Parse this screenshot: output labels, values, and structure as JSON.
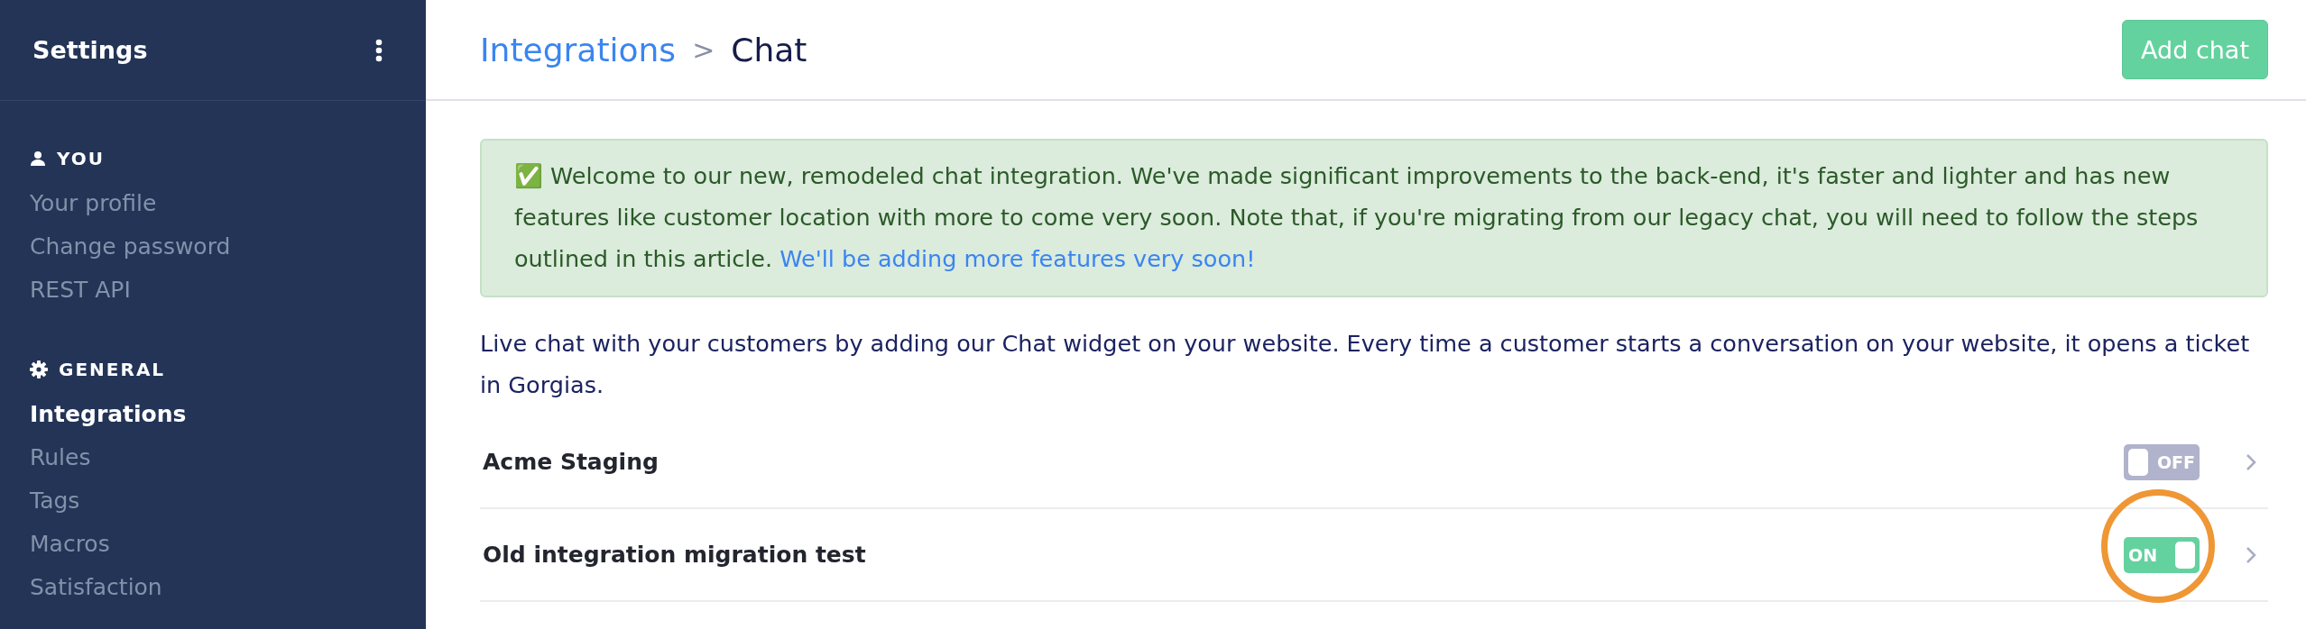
{
  "sidebar": {
    "title": "Settings",
    "sections": [
      {
        "kind": "user",
        "heading": "YOU",
        "items": [
          {
            "label": "Your profile",
            "selected": false
          },
          {
            "label": "Change password",
            "selected": false
          },
          {
            "label": "REST API",
            "selected": false
          }
        ]
      },
      {
        "kind": "gear",
        "heading": "GENERAL",
        "items": [
          {
            "label": "Integrations",
            "selected": true
          },
          {
            "label": "Rules",
            "selected": false
          },
          {
            "label": "Tags",
            "selected": false
          },
          {
            "label": "Macros",
            "selected": false
          },
          {
            "label": "Satisfaction",
            "selected": false
          }
        ]
      }
    ]
  },
  "header": {
    "breadcrumb": [
      {
        "label": "Integrations",
        "selected": false
      },
      {
        "label": "Chat",
        "selected": true
      }
    ],
    "separator": ">",
    "button": "Add chat"
  },
  "alert": {
    "emoji": "✅",
    "text": "Welcome to our new, remodeled chat integration. We've made significant improvements to the back-end, it's faster and lighter and has new features like customer location with more to come very soon. Note that, if you're migrating from our legacy chat, you will need to follow the steps outlined in this article.",
    "link": "We'll be adding more features very soon!"
  },
  "description": "Live chat with your customers by adding our Chat widget on your website. Every time a customer starts a conversation on your website, it opens a ticket in Gorgias.",
  "integrations": [
    {
      "name": "Acme Staging",
      "on": false,
      "toggle_label": "OFF",
      "highlighted": false
    },
    {
      "name": "Old integration migration test",
      "on": true,
      "toggle_label": "ON",
      "highlighted": true
    }
  ]
}
